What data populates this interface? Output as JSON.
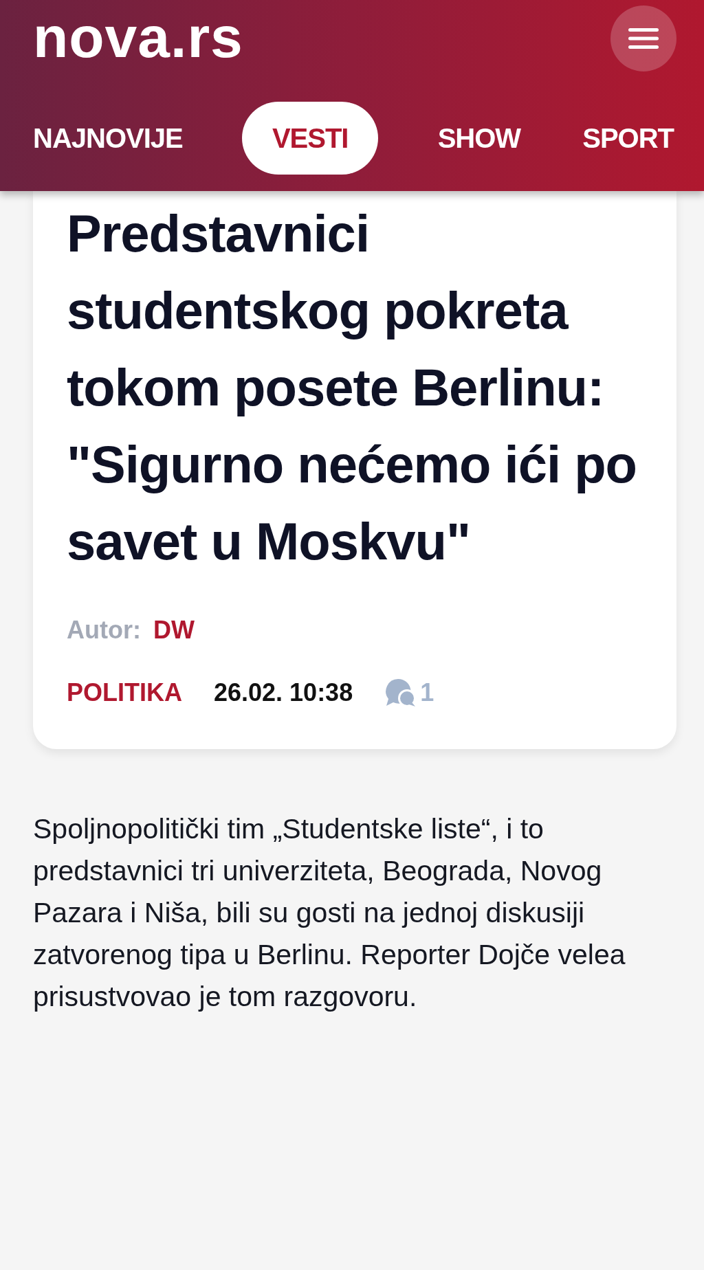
{
  "header": {
    "logo": "nova.rs"
  },
  "tabs": [
    {
      "label": "NAJNOVIJE",
      "selected": false
    },
    {
      "label": "VESTI",
      "selected": true
    },
    {
      "label": "SHOW",
      "selected": false
    },
    {
      "label": "SPORT",
      "selected": false
    }
  ],
  "article": {
    "title": "Predstavnici studentskog pokreta tokom posete Berlinu: \"Sigurno nećemo ići po savet u Moskvu\"",
    "author_label": "Autor:",
    "author": "DW",
    "category": "POLITIKA",
    "date": "26.02. 10:38",
    "comments": "1"
  },
  "lead": "Spoljnopolitički tim „Studentske liste“, i to predstavnici tri univerziteta, Beograda, Novog Pazara i Niša, bili su gosti na jednoj diskusiji zatvorenog tipa u Berlinu. Reporter Dojče velea prisustvovao je tom razgovoru."
}
